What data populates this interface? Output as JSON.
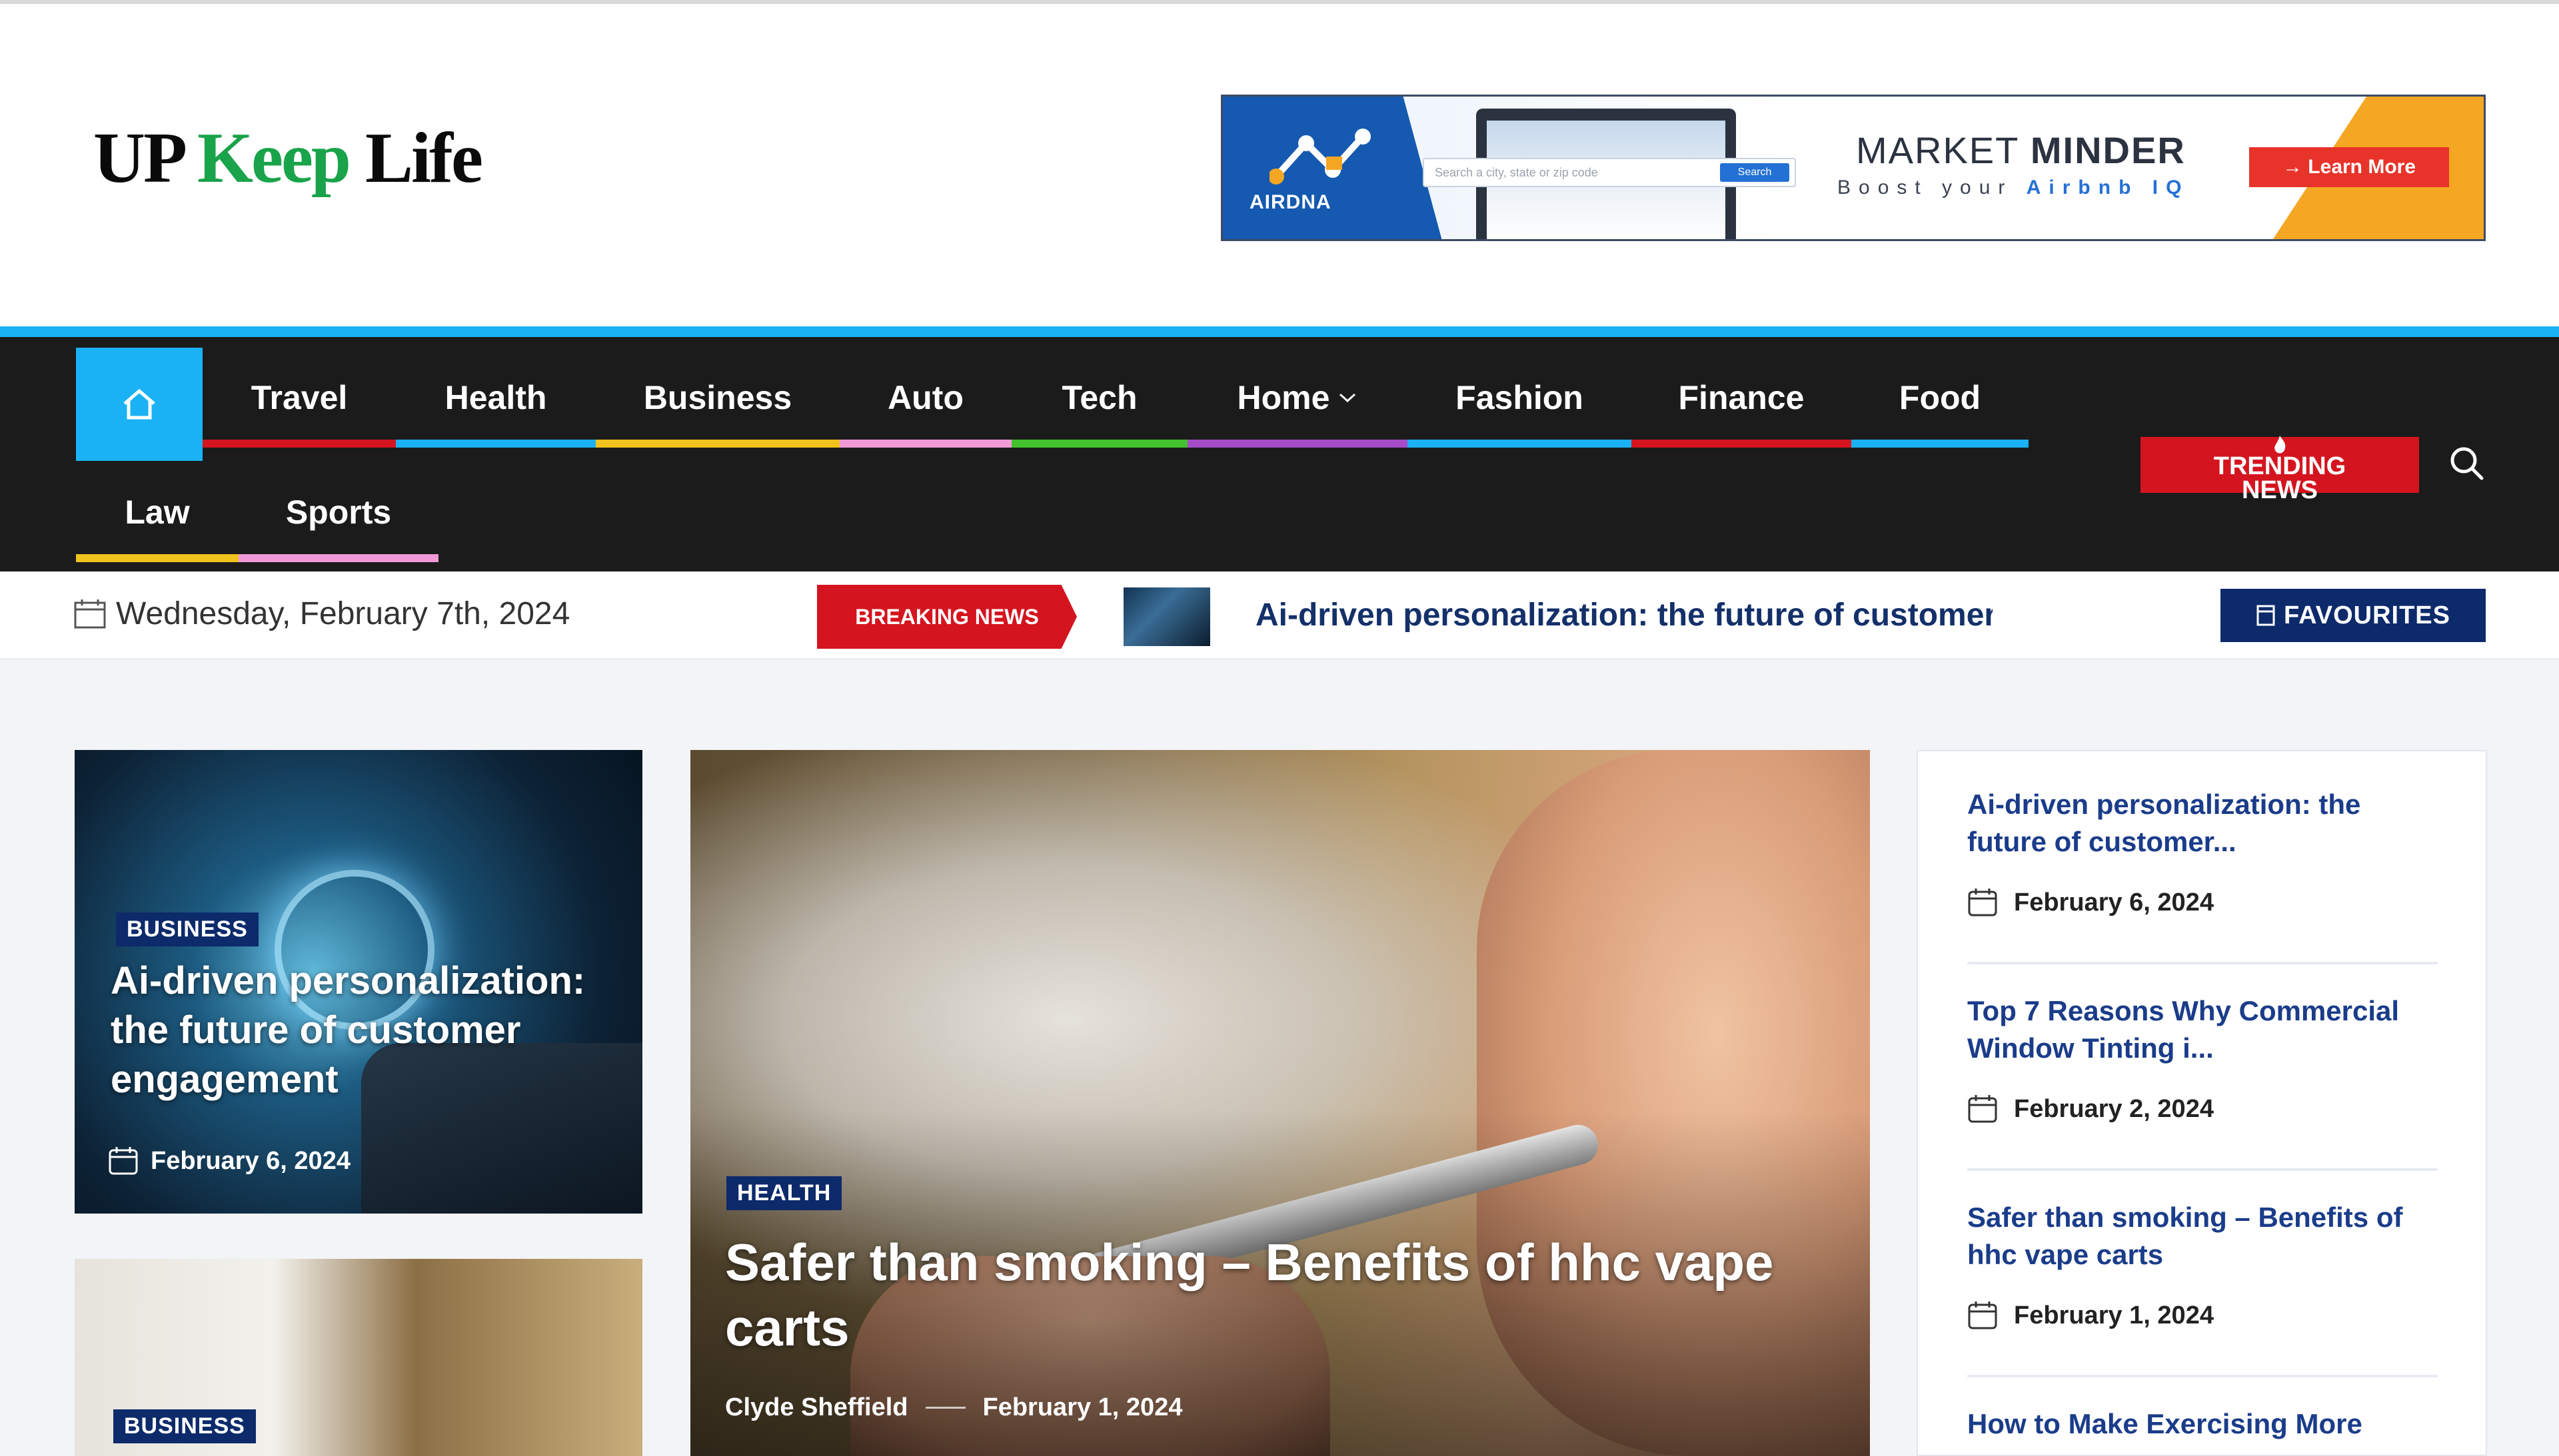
{
  "logo": {
    "part1": "UP ",
    "part2": "Keep",
    "part3": " Life"
  },
  "ad": {
    "brand": "AIRDNA",
    "search_placeholder": "Search a city, state or zip code",
    "search_button": "Search",
    "title_light": "MARKET ",
    "title_bold": "MINDER",
    "subtitle_prefix": "Boost your ",
    "subtitle_highlight": "Airbnb IQ",
    "cta": "→ Learn More"
  },
  "nav": {
    "items": [
      {
        "label": "Travel",
        "color": "#d4141f"
      },
      {
        "label": "Health",
        "color": "#1ab2f5"
      },
      {
        "label": "Business",
        "color": "#f2c31c"
      },
      {
        "label": "Auto",
        "color": "#f29ad8"
      },
      {
        "label": "Tech",
        "color": "#42c22c"
      },
      {
        "label": "Home",
        "color": "#a64bc8",
        "has_dropdown": true
      },
      {
        "label": "Fashion",
        "color": "#1ab2f5"
      },
      {
        "label": "Finance",
        "color": "#d4141f"
      },
      {
        "label": "Food",
        "color": "#1ab2f5"
      },
      {
        "label": "Law",
        "color": "#f2c31c"
      },
      {
        "label": "Sports",
        "color": "#f29ad8"
      }
    ],
    "trending_line1": "TRENDING",
    "trending_line2": "NEWS"
  },
  "infobar": {
    "date": "Wednesday, February 7th, 2024",
    "breaking_label": "BREAKING NEWS",
    "ticker_text": "Ai-driven personalization: the future of customer engagement",
    "favourites_label": "FAVOURITES"
  },
  "cards": {
    "card1": {
      "category": "BUSINESS",
      "title": "Ai-driven personalization: the future of customer engagement",
      "date": "February 6, 2024"
    },
    "card2": {
      "category": "BUSINESS"
    },
    "hero": {
      "category": "HEALTH",
      "title": "Safer than smoking – Benefits of hhc vape carts",
      "author": "Clyde Sheffield",
      "date": "February 1, 2024"
    }
  },
  "sidebar": {
    "items": [
      {
        "title": "Ai-driven personalization: the future of customer...",
        "date": "February 6, 2024"
      },
      {
        "title": "Top 7 Reasons Why Commercial Window Tinting i...",
        "date": "February 2, 2024"
      },
      {
        "title": "Safer than smoking – Benefits of hhc vape carts",
        "date": "February 1, 2024"
      },
      {
        "title": "How to Make Exercising More"
      }
    ]
  },
  "colors": {
    "accent": "#1ab2f5",
    "brand_navy": "#0d2a6b",
    "breaking_red": "#d4141f",
    "nav_bg": "#1b1b1b",
    "logo_green": "#19a34a"
  }
}
